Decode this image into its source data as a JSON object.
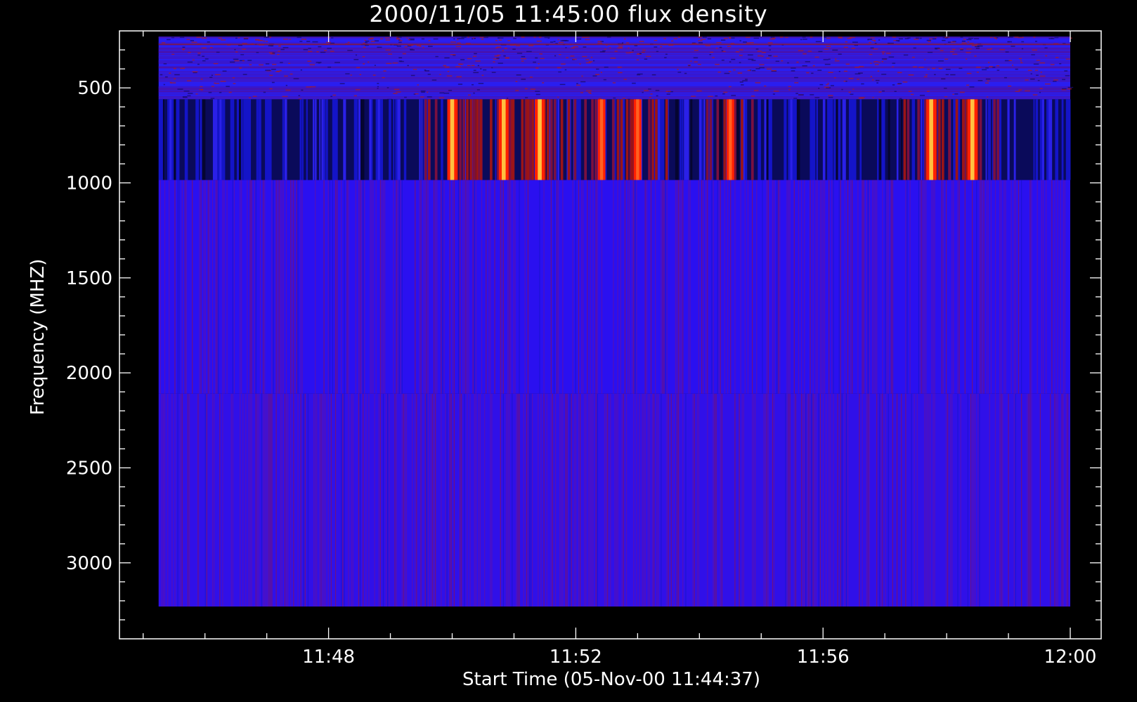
{
  "chart_data": {
    "type": "heatmap",
    "title": "2000/11/05 11:45:00 flux density",
    "xlabel": "Start Time (05-Nov-00 11:44:37)",
    "ylabel": "Frequency (MHZ)",
    "x_range": [
      "11:44:37",
      "12:00:30"
    ],
    "x_ticks": [
      "11:48",
      "11:52",
      "11:56",
      "12:00"
    ],
    "y_range": [
      200,
      3400
    ],
    "y_reversed": true,
    "y_ticks": [
      500,
      1000,
      1500,
      2000,
      2500,
      3000
    ],
    "data_extent": {
      "time": [
        "11:45:15",
        "12:00:00"
      ],
      "freq": [
        230,
        3230
      ]
    },
    "bands": [
      {
        "freq": [
          230,
          560
        ],
        "base": "#2a1ef0",
        "texture": "mottled"
      },
      {
        "freq": [
          560,
          985
        ],
        "base": "#0a0a5a",
        "texture": "bursts"
      },
      {
        "freq": [
          985,
          2110
        ],
        "base": "#2a10f0",
        "texture": "streaks"
      },
      {
        "freq": [
          2110,
          3230
        ],
        "base": "#3010e8",
        "texture": "streaks"
      }
    ],
    "bursts": [
      {
        "time": "11:50:00",
        "intensity": "high"
      },
      {
        "time": "11:50:50",
        "intensity": "high"
      },
      {
        "time": "11:51:25",
        "intensity": "high"
      },
      {
        "time": "11:52:25",
        "intensity": "medium"
      },
      {
        "time": "11:53:00",
        "intensity": "medium"
      },
      {
        "time": "11:54:30",
        "intensity": "medium"
      },
      {
        "time": "11:57:45",
        "intensity": "high"
      },
      {
        "time": "11:58:25",
        "intensity": "high"
      }
    ],
    "colors": {
      "background": "#000000",
      "axes": "#ffffff",
      "low": "#0a0a5a",
      "mid": "#2a1ef0",
      "high": "#ff2000",
      "peak": "#ffc040"
    },
    "grid": false,
    "legend": "none"
  }
}
